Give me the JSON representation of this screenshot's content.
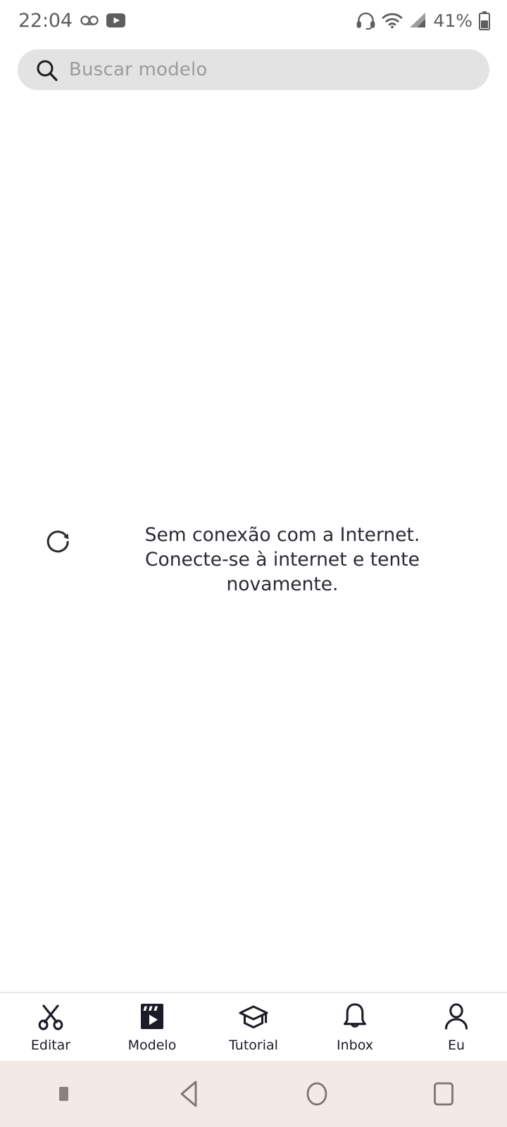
{
  "status_bar": {
    "time": "22:04",
    "left_icons": [
      "voicemail-icon",
      "youtube-icon"
    ],
    "right_icons": [
      "headset-icon",
      "wifi-icon",
      "cellular-signal-icon"
    ],
    "battery_percent": "41%",
    "text_color": "#5e5e5e"
  },
  "search": {
    "placeholder": "Buscar modelo",
    "value": "",
    "icon": "search-icon",
    "background": "#e3e3e3"
  },
  "main": {
    "empty_state": {
      "icon": "refresh-icon",
      "message": "Sem conexão com a Internet. Conecte-se à internet e tente novamente."
    }
  },
  "tab_bar": {
    "active_index": 1,
    "items": [
      {
        "label": "Editar",
        "icon": "scissors-icon"
      },
      {
        "label": "Modelo",
        "icon": "clapperboard-play-icon"
      },
      {
        "label": "Tutorial",
        "icon": "graduation-cap-icon"
      },
      {
        "label": "Inbox",
        "icon": "bell-icon"
      },
      {
        "label": "Eu",
        "icon": "person-icon"
      }
    ]
  },
  "android_nav": {
    "background": "#f2eae7",
    "items": [
      "menu-dot-icon",
      "back-icon",
      "home-icon",
      "recents-icon"
    ]
  }
}
